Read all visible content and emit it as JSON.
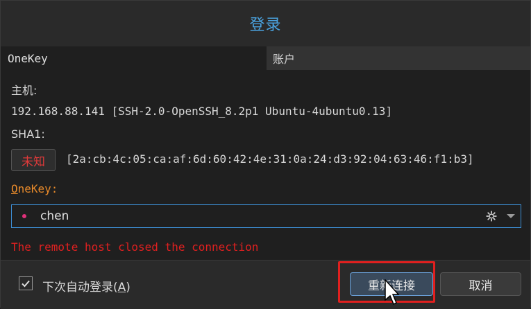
{
  "dialog": {
    "title": "登录"
  },
  "tabs": [
    {
      "label": "OneKey",
      "active": true
    },
    {
      "label": "账户",
      "active": false
    }
  ],
  "host": {
    "label": "主机:",
    "value": "192.168.88.141 [SSH-2.0-OpenSSH_8.2p1 Ubuntu-4ubuntu0.13]"
  },
  "sha1": {
    "label": "SHA1:",
    "status": "未知",
    "fingerprint": "[2a:cb:4c:05:ca:af:6d:60:42:4e:31:0a:24:d3:92:04:63:46:f1:b3]"
  },
  "onekey": {
    "label_mnemonic": "O",
    "label_rest": "neKey:",
    "selected": "chen",
    "dot_color": "#e0307a",
    "settings_icon": "gear-icon",
    "dropdown_icon": "chevron-down-icon"
  },
  "error": {
    "message": "The remote host closed the connection"
  },
  "footer": {
    "auto_login_checked": true,
    "auto_login_label": "下次自动登录(",
    "auto_login_mnemonic": "A",
    "auto_login_label_end": ")",
    "reconnect_label": "重新连接",
    "cancel_label": "取消"
  },
  "colors": {
    "accent": "#4aa3e0",
    "error": "#e02020",
    "warning_label": "#e88a2a",
    "highlight": "#e0201f"
  }
}
